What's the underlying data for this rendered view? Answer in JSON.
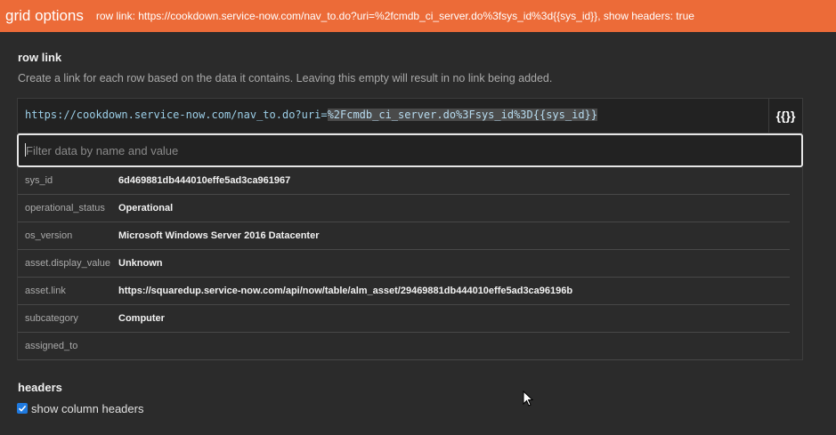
{
  "header": {
    "title": "grid options",
    "summary": "row link: https://cookdown.service-now.com/nav_to.do?uri=%2fcmdb_ci_server.do%3fsys_id%3d{{sys_id}}, show headers: true"
  },
  "row_link": {
    "title": "row link",
    "description": "Create a link for each row based on the data it contains. Leaving this empty will result in no link being added.",
    "value_plain": "https://cookdown.service-now.com/nav_to.do?uri=",
    "value_selected": "%2Fcmdb_ci_server.do%3Fsys_id%3D{{sys_id}}",
    "variable_button": "{{}}",
    "filter_placeholder": "Filter data by name and value"
  },
  "data_rows": [
    {
      "key": "sys_id",
      "value": "6d469881db444010effe5ad3ca961967"
    },
    {
      "key": "operational_status",
      "value": "Operational"
    },
    {
      "key": "os_version",
      "value": "Microsoft Windows Server 2016 Datacenter"
    },
    {
      "key": "asset.display_value",
      "value": "Unknown"
    },
    {
      "key": "asset.link",
      "value": "https://squaredup.service-now.com/api/now/table/alm_asset/29469881db444010effe5ad3ca96196b"
    },
    {
      "key": "subcategory",
      "value": "Computer"
    },
    {
      "key": "assigned_to",
      "value": ""
    }
  ],
  "headers": {
    "title": "headers",
    "show_column_headers_label": "show column headers",
    "show_column_headers": true
  },
  "colors": {
    "accent": "#ec6b38",
    "background": "#2b2b2b",
    "checkbox": "#1f7ae0"
  }
}
